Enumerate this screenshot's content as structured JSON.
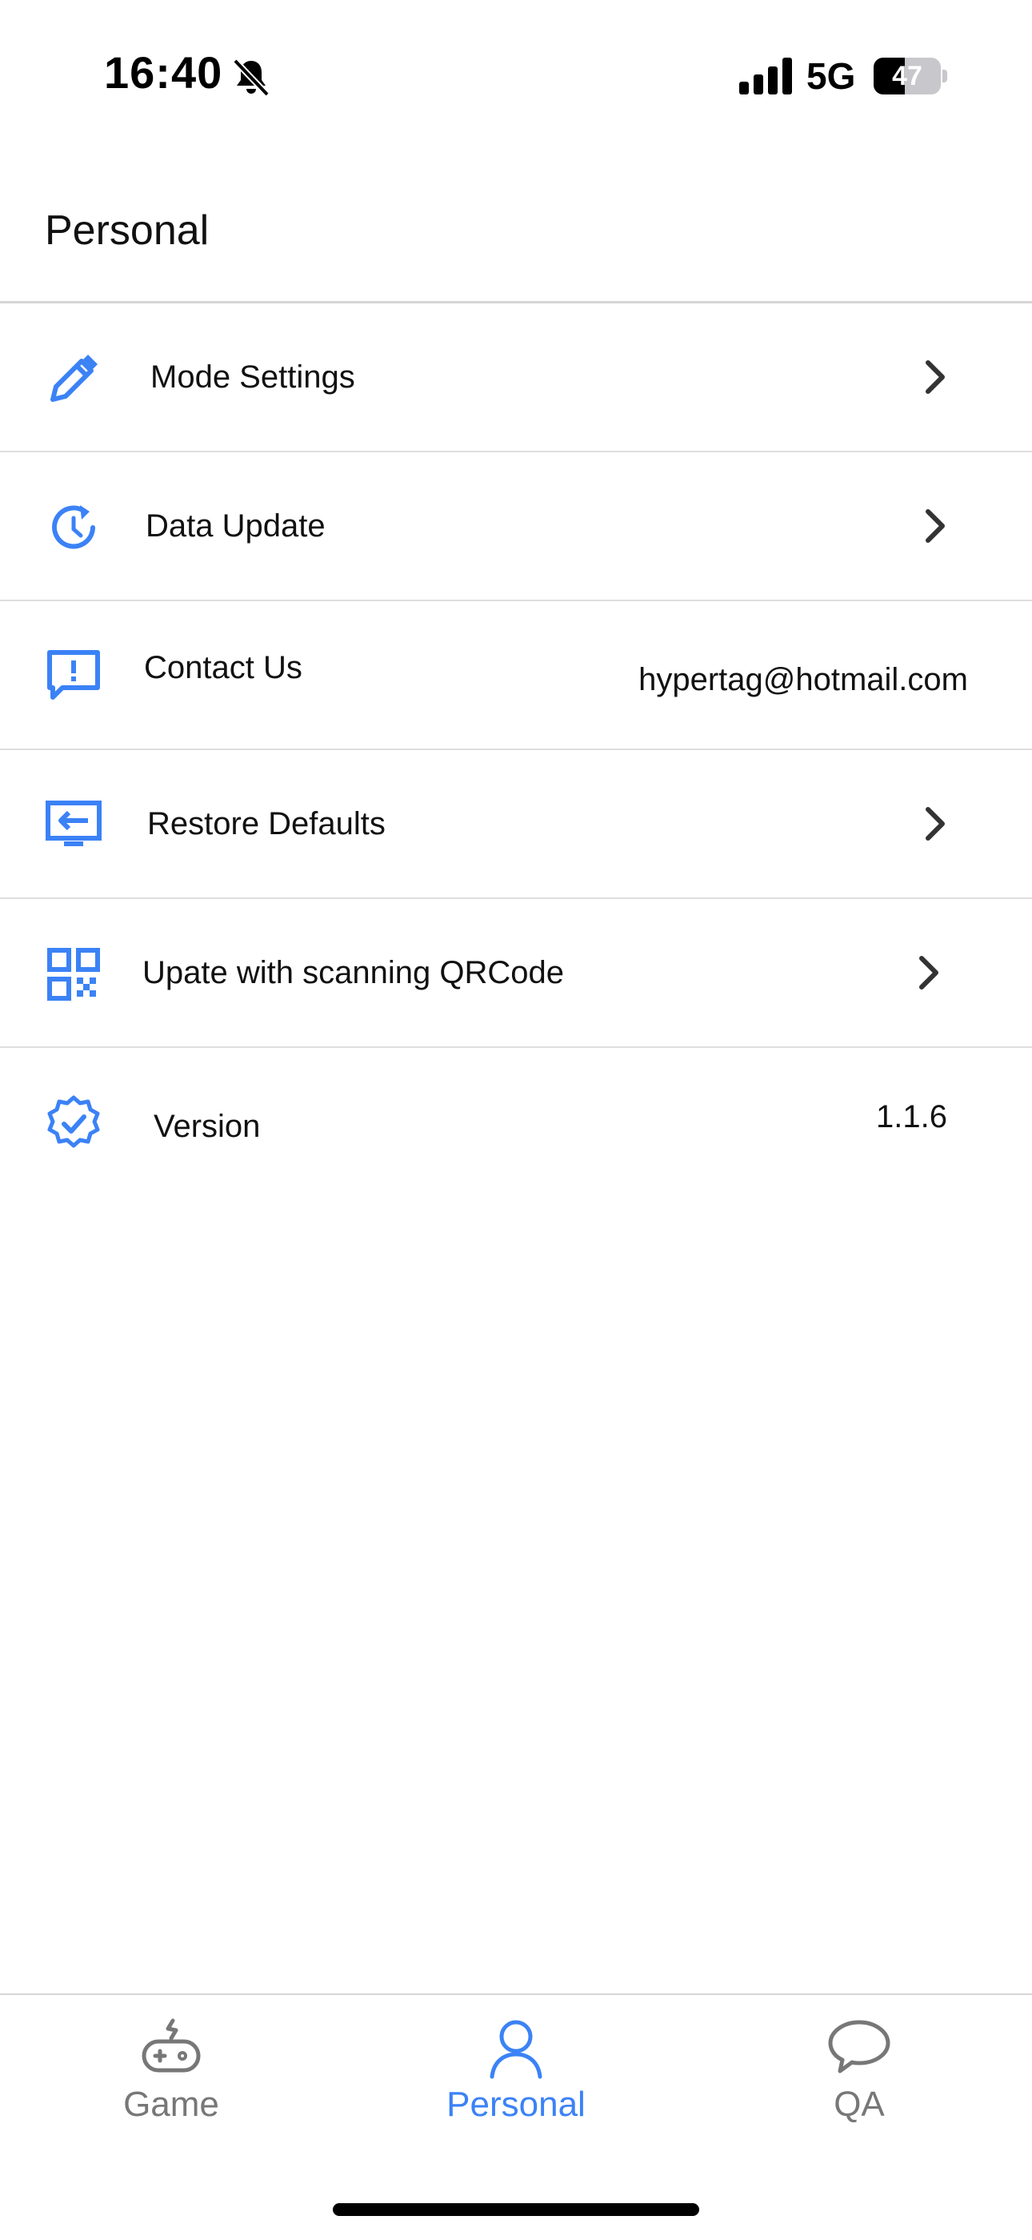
{
  "status_bar": {
    "time": "16:40",
    "network": "5G",
    "battery": "47",
    "battery_level": 0.47
  },
  "header": {
    "title": "Personal"
  },
  "accent_color": "#3b82f6",
  "menu": [
    {
      "label": "Mode Settings",
      "icon": "pencil-icon",
      "value": "",
      "chevron": true
    },
    {
      "label": "Data Update",
      "icon": "history-icon",
      "value": "",
      "chevron": true
    },
    {
      "label": "Contact Us",
      "icon": "feedback-icon",
      "value": "hypertag@hotmail.com",
      "chevron": false
    },
    {
      "label": "Restore Defaults",
      "icon": "restore-screen-icon",
      "value": "",
      "chevron": true
    },
    {
      "label": "Upate with scanning QRCode",
      "icon": "qrcode-icon",
      "value": "",
      "chevron": true
    },
    {
      "label": "Version",
      "icon": "verified-badge-icon",
      "value": "1.1.6",
      "chevron": false
    }
  ],
  "tab_bar": {
    "tabs": [
      {
        "label": "Game",
        "icon": "gamepad-icon",
        "active": false
      },
      {
        "label": "Personal",
        "icon": "person-icon",
        "active": true
      },
      {
        "label": "QA",
        "icon": "chat-bubble-icon",
        "active": false
      }
    ]
  }
}
